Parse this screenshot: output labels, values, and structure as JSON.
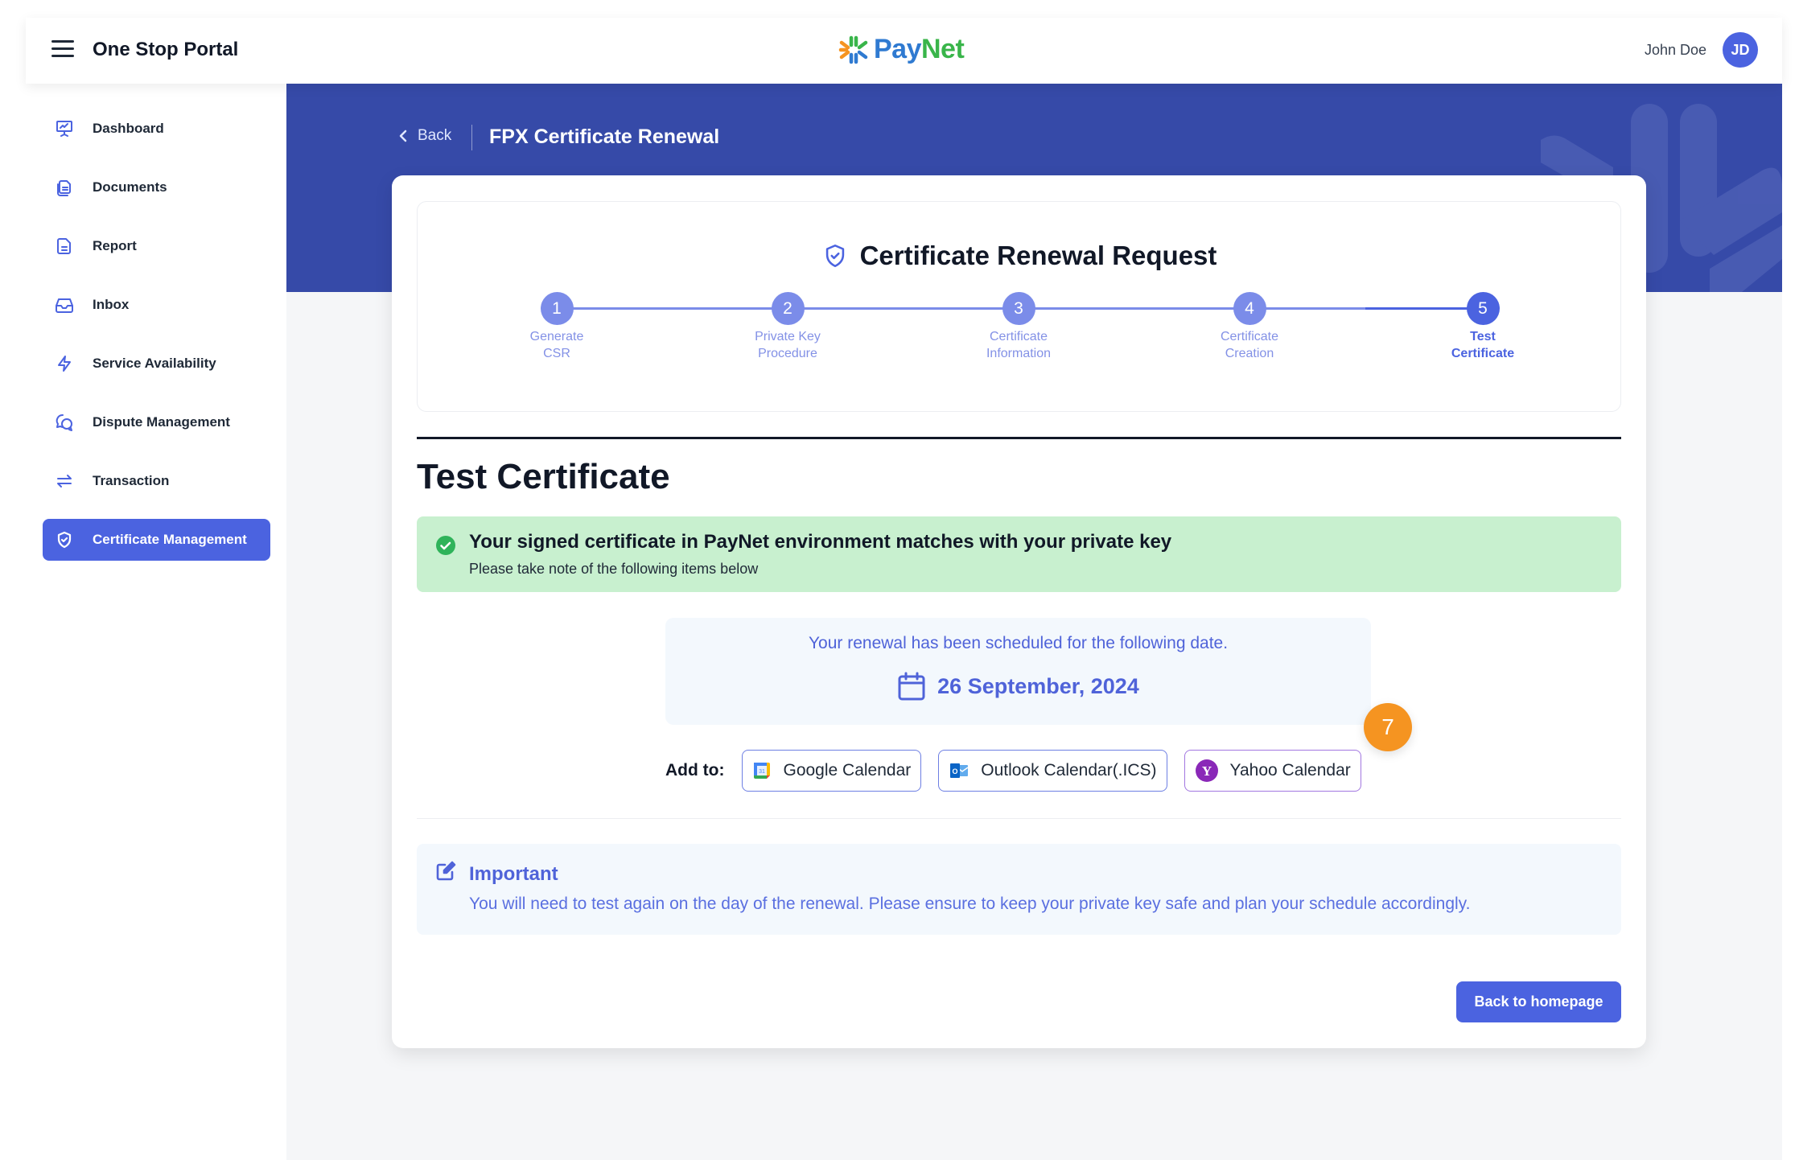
{
  "header": {
    "app_title": "One Stop Portal",
    "logo": {
      "pay": "Pay",
      "net": "Net"
    },
    "user_name": "John Doe",
    "user_initials": "JD"
  },
  "sidebar": {
    "items": [
      {
        "label": "Dashboard",
        "icon": "presentation-chart-icon",
        "active": false
      },
      {
        "label": "Documents",
        "icon": "documents-icon",
        "active": false
      },
      {
        "label": "Report",
        "icon": "report-file-icon",
        "active": false
      },
      {
        "label": "Inbox",
        "icon": "inbox-icon",
        "active": false
      },
      {
        "label": "Service Availability",
        "icon": "lightning-icon",
        "active": false
      },
      {
        "label": "Dispute Management",
        "icon": "chat-bubbles-icon",
        "active": false
      },
      {
        "label": "Transaction",
        "icon": "arrows-exchange-icon",
        "active": false
      },
      {
        "label": "Certificate Management",
        "icon": "shield-check-icon",
        "active": true
      }
    ]
  },
  "page": {
    "back_label": "Back",
    "heading": "FPX Certificate Renewal"
  },
  "stepper": {
    "title": "Certificate Renewal Request",
    "steps": [
      {
        "number": "1",
        "line1": "Generate",
        "line2": "CSR",
        "active": false
      },
      {
        "number": "2",
        "line1": "Private Key",
        "line2": "Procedure",
        "active": false
      },
      {
        "number": "3",
        "line1": "Certificate",
        "line2": "Information",
        "active": false
      },
      {
        "number": "4",
        "line1": "Certificate",
        "line2": "Creation",
        "active": false
      },
      {
        "number": "5",
        "line1": "Test",
        "line2": "Certificate",
        "active": true
      }
    ]
  },
  "content": {
    "section_title": "Test Certificate",
    "alert": {
      "title": "Your signed certificate in PayNet environment matches with your private key",
      "subtitle": "Please take note of the following items below"
    },
    "schedule": {
      "note": "Your renewal has been scheduled for the following date.",
      "date": "26 September, 2024"
    },
    "add_to": {
      "label": "Add to:",
      "buttons": [
        {
          "label": "Google Calendar",
          "icon": "google-calendar-icon"
        },
        {
          "label": "Outlook Calendar(.ICS)",
          "icon": "outlook-icon"
        },
        {
          "label": "Yahoo Calendar",
          "icon": "yahoo-icon"
        }
      ]
    },
    "annotation_badge": "7",
    "important": {
      "title": "Important",
      "text": "You will need to test again on the day of the renewal. Please ensure to keep your private key safe and plan your schedule accordingly."
    },
    "home_button": "Back to homepage"
  },
  "colors": {
    "primary": "#4b63e0",
    "banner": "#364aa8",
    "success_bg": "#c8f0cf",
    "success_icon": "#2fb35a",
    "info_bg": "#f3f8fd",
    "badge": "#f59421"
  }
}
